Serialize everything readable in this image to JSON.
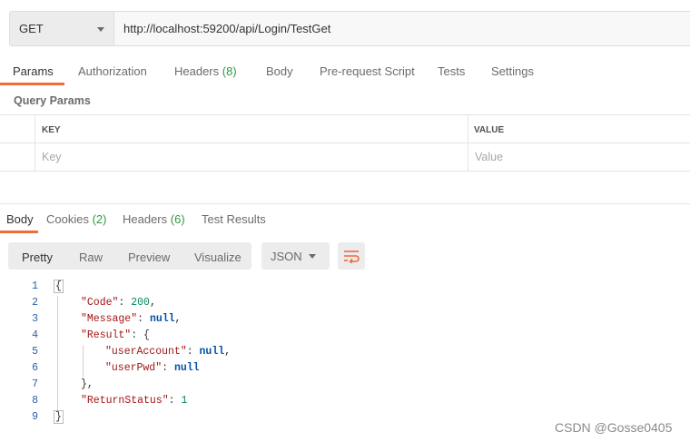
{
  "request": {
    "method": "GET",
    "url": "http://localhost:59200/api/Login/TestGet"
  },
  "request_tabs": [
    {
      "label": "Params"
    },
    {
      "label": "Authorization"
    },
    {
      "label": "Headers",
      "count": "(8)"
    },
    {
      "label": "Body"
    },
    {
      "label": "Pre-request Script"
    },
    {
      "label": "Tests"
    },
    {
      "label": "Settings"
    }
  ],
  "params": {
    "title": "Query Params",
    "columns": [
      "KEY",
      "VALUE"
    ],
    "key_placeholder": "Key",
    "value_placeholder": "Value"
  },
  "response_tabs": [
    {
      "label": "Body"
    },
    {
      "label": "Cookies",
      "count": "(2)"
    },
    {
      "label": "Headers",
      "count": "(6)"
    },
    {
      "label": "Test Results"
    }
  ],
  "view_modes": [
    "Pretty",
    "Raw",
    "Preview",
    "Visualize"
  ],
  "format": "JSON",
  "code_lines": [
    "1",
    "2",
    "3",
    "4",
    "5",
    "6",
    "7",
    "8",
    "9"
  ],
  "json": {
    "code_key": "\"Code\"",
    "code_val": "200",
    "message_key": "\"Message\"",
    "message_val": "null",
    "result_key": "\"Result\"",
    "account_key": "\"userAccount\"",
    "account_val": "null",
    "pwd_key": "\"userPwd\"",
    "pwd_val": "null",
    "status_key": "\"ReturnStatus\"",
    "status_val": "1"
  },
  "watermark": "CSDN @Gosse0405",
  "colors": {
    "accent": "#f26b3a",
    "count": "#2d9a3f"
  }
}
